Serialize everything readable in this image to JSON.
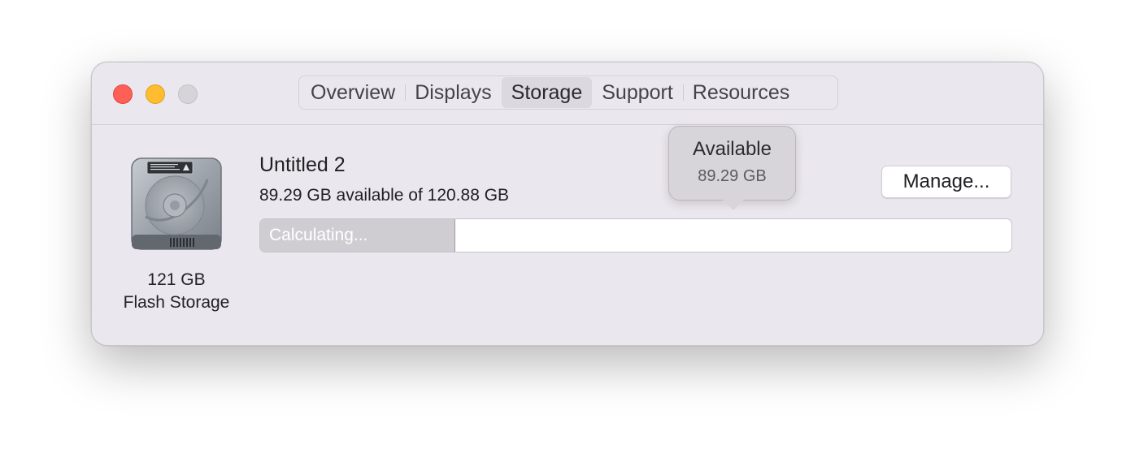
{
  "window": {
    "tabs": [
      {
        "label": "Overview"
      },
      {
        "label": "Displays"
      },
      {
        "label": "Storage"
      },
      {
        "label": "Support"
      },
      {
        "label": "Resources"
      }
    ],
    "selected_tab": "Storage"
  },
  "disk": {
    "icon": "hard-drive-icon",
    "size": "121 GB",
    "type": "Flash Storage"
  },
  "volume": {
    "name": "Untitled 2",
    "availability": "89.29 GB available of 120.88 GB",
    "bar_status": "Calculating...",
    "used_fraction": 0.26,
    "manage_label": "Manage..."
  },
  "tooltip": {
    "title": "Available",
    "value": "89.29 GB"
  },
  "colors": {
    "close": "#fe5f57",
    "minimize": "#febc2e",
    "zoom": "#d6d3d9",
    "window_bg": "#ebe7ee",
    "bar_used": "#d0cdd2"
  }
}
